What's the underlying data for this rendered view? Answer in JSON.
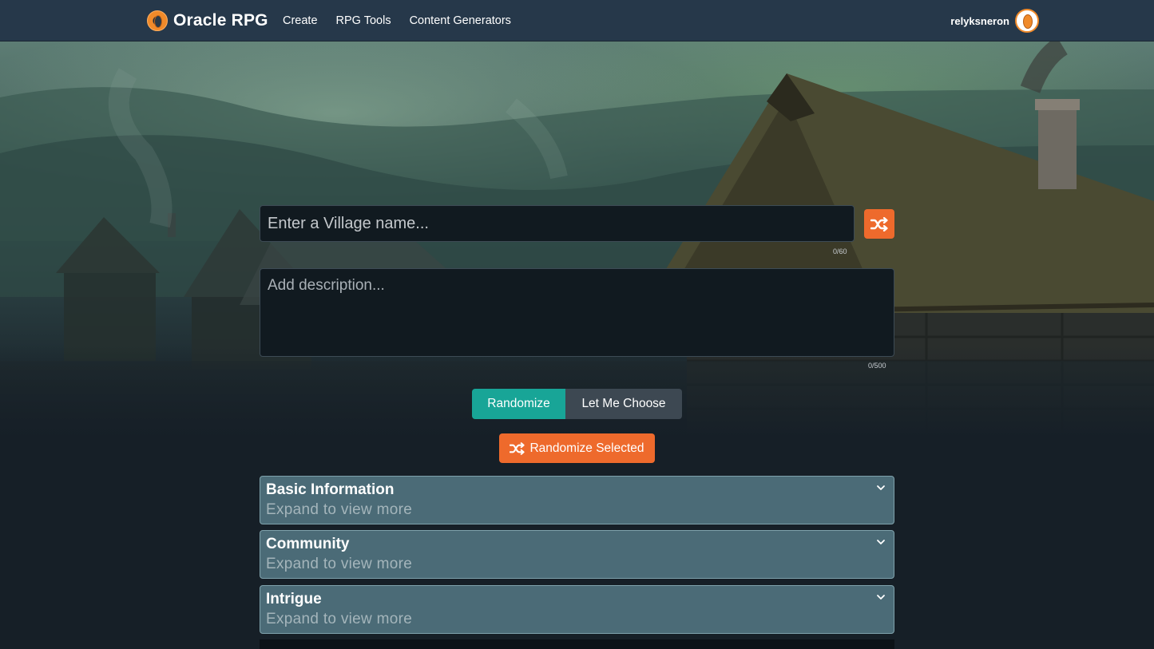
{
  "nav": {
    "brand": "Oracle RPG",
    "links": [
      "Create",
      "RPG Tools",
      "Content Generators"
    ],
    "username": "relyksneron"
  },
  "form": {
    "name_placeholder": "Enter a Village name...",
    "name_value": "",
    "name_counter": "0/60",
    "description_placeholder": "Add description...",
    "description_value": "",
    "description_counter": "0/500"
  },
  "mode": {
    "randomize": "Randomize",
    "let_me_choose": "Let Me Choose",
    "selected": "Randomize"
  },
  "actions": {
    "randomize_selected": "Randomize Selected"
  },
  "sections": [
    {
      "title": "Basic Information",
      "subtitle": "Expand to view more"
    },
    {
      "title": "Community",
      "subtitle": "Expand to view more"
    },
    {
      "title": "Intrigue",
      "subtitle": "Expand to view more"
    }
  ],
  "colors": {
    "accent_orange": "#ee6a2c",
    "accent_teal": "#18a597",
    "nav_bg": "#26384a",
    "section_bg": "#4b6b77"
  },
  "icons": {
    "shuffle": "shuffle-icon",
    "chevron": "chevron-down-icon"
  }
}
